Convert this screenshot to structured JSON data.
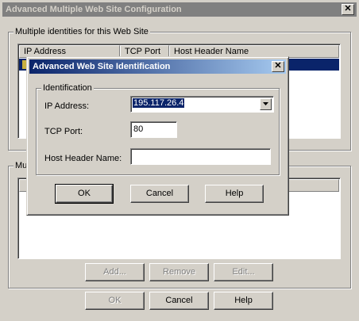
{
  "outer_window": {
    "title": "Advanced Multiple Web Site Configuration",
    "close_glyph": "✕",
    "identities_group": {
      "label": "Multiple identities for this Web Site",
      "columns": [
        "IP Address",
        "TCP Port",
        "Host Header Name"
      ]
    },
    "second_group": {
      "label_visible": "Mul"
    },
    "list_buttons": {
      "add": "Add...",
      "remove": "Remove",
      "edit": "Edit..."
    },
    "footer_buttons": {
      "ok": "OK",
      "cancel": "Cancel",
      "help": "Help"
    }
  },
  "inner_dialog": {
    "title": "Advanced Web Site Identification",
    "group_label": "Identification",
    "ip_label": "IP Address:",
    "ip_value": "195.117.26.4",
    "port_label": "TCP Port:",
    "port_value": "80",
    "host_label": "Host Header Name:",
    "host_value": "",
    "buttons": {
      "ok": "OK",
      "cancel": "Cancel",
      "help": "Help"
    }
  },
  "colors": {
    "face": "#d4d0c8",
    "selection": "#0a246a",
    "title_active_start": "#0a246a",
    "title_inactive": "#808080"
  }
}
